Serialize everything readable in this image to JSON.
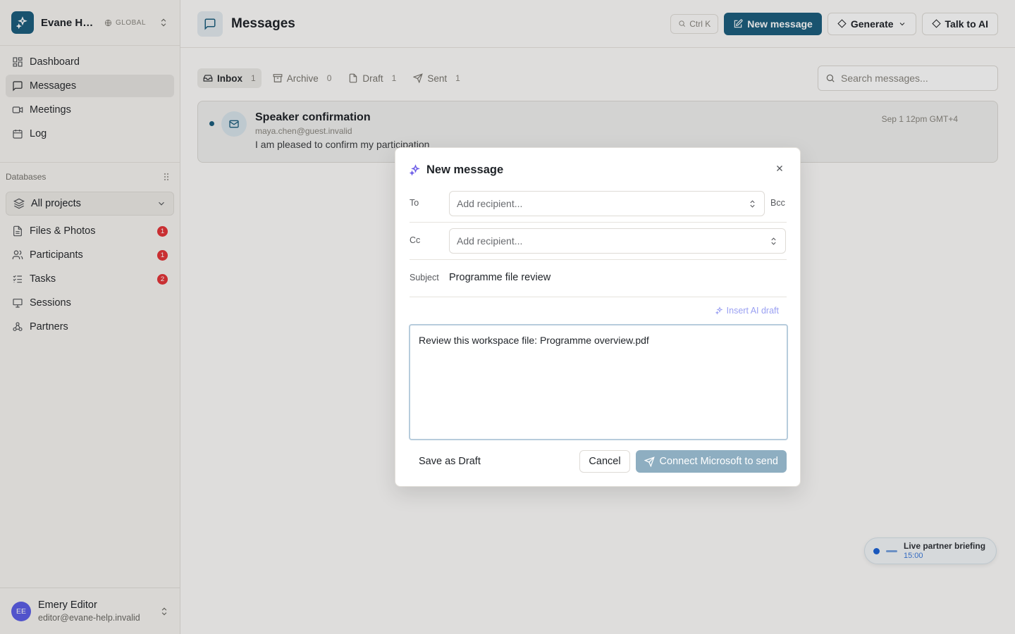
{
  "workspace": {
    "name": "Evane Help",
    "scope": "GLOBAL"
  },
  "nav": [
    {
      "label": "Dashboard",
      "icon": "grid-icon"
    },
    {
      "label": "Messages",
      "icon": "message-square-icon",
      "active": true
    },
    {
      "label": "Meetings",
      "icon": "video-icon"
    },
    {
      "label": "Log",
      "icon": "calendar-icon"
    }
  ],
  "databases": {
    "label": "Databases",
    "project_select": "All projects",
    "items": [
      {
        "label": "Files & Photos",
        "badge": "1"
      },
      {
        "label": "Participants",
        "badge": "1"
      },
      {
        "label": "Tasks",
        "badge": "2"
      },
      {
        "label": "Sessions",
        "badge": ""
      },
      {
        "label": "Partners",
        "badge": ""
      }
    ]
  },
  "user": {
    "initials": "EE",
    "name": "Emery Editor",
    "email": "editor@evane-help.invalid"
  },
  "topbar": {
    "title": "Messages",
    "shortcut": "Ctrl K",
    "new_message": "New message",
    "generate": "Generate",
    "talk_ai": "Talk to AI"
  },
  "tabs": [
    {
      "label": "Inbox",
      "count": "1"
    },
    {
      "label": "Archive",
      "count": "0"
    },
    {
      "label": "Draft",
      "count": "1"
    },
    {
      "label": "Sent",
      "count": "1"
    }
  ],
  "search": {
    "placeholder": "Search messages..."
  },
  "message": {
    "subject": "Speaker confirmation",
    "from": "maya.chen@guest.invalid",
    "preview": "I am pleased to confirm my participation",
    "date": "Sep 1 12pm GMT+4"
  },
  "live": {
    "title": "Live partner briefing",
    "time": "15:00"
  },
  "modal": {
    "title": "New message",
    "to_label": "To",
    "cc_label": "Cc",
    "bcc_label": "Bcc",
    "recipient_placeholder": "Add recipient...",
    "subject_label": "Subject",
    "subject_value": "Programme file review",
    "ai_draft": "Insert AI draft",
    "body": "Review this workspace file: Programme overview.pdf",
    "save_draft": "Save as Draft",
    "cancel": "Cancel",
    "send": "Connect Microsoft to send"
  },
  "colors": {
    "brand": "#1d5f7f",
    "badge": "#e5363a",
    "ai": "#9aa0f2",
    "avatar": "#5d5fe8"
  }
}
